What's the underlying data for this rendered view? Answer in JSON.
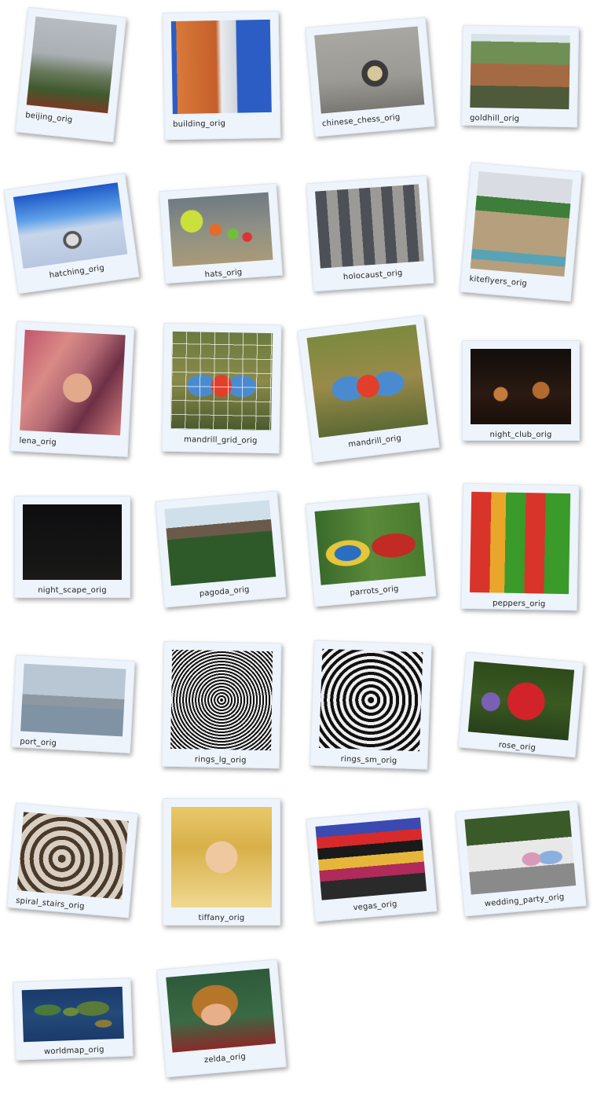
{
  "gallery": {
    "items": [
      {
        "label": "beijing_orig"
      },
      {
        "label": "building_orig"
      },
      {
        "label": "chinese_chess_orig"
      },
      {
        "label": "goldhill_orig"
      },
      {
        "label": "hatching_orig"
      },
      {
        "label": "hats_orig"
      },
      {
        "label": "holocaust_orig"
      },
      {
        "label": "kiteflyers_orig"
      },
      {
        "label": "lena_orig"
      },
      {
        "label": "mandrill_grid_orig"
      },
      {
        "label": "mandrill_orig"
      },
      {
        "label": "night_club_orig"
      },
      {
        "label": "night_scape_orig"
      },
      {
        "label": "pagoda_orig"
      },
      {
        "label": "parrots_orig"
      },
      {
        "label": "peppers_orig"
      },
      {
        "label": "port_orig"
      },
      {
        "label": "rings_lg_orig"
      },
      {
        "label": "rings_sm_orig"
      },
      {
        "label": "rose_orig"
      },
      {
        "label": "spiral_stairs_orig"
      },
      {
        "label": "tiffany_orig"
      },
      {
        "label": "vegas_orig"
      },
      {
        "label": "wedding_party_orig"
      },
      {
        "label": "worldmap_orig"
      },
      {
        "label": "zelda_orig"
      }
    ]
  }
}
